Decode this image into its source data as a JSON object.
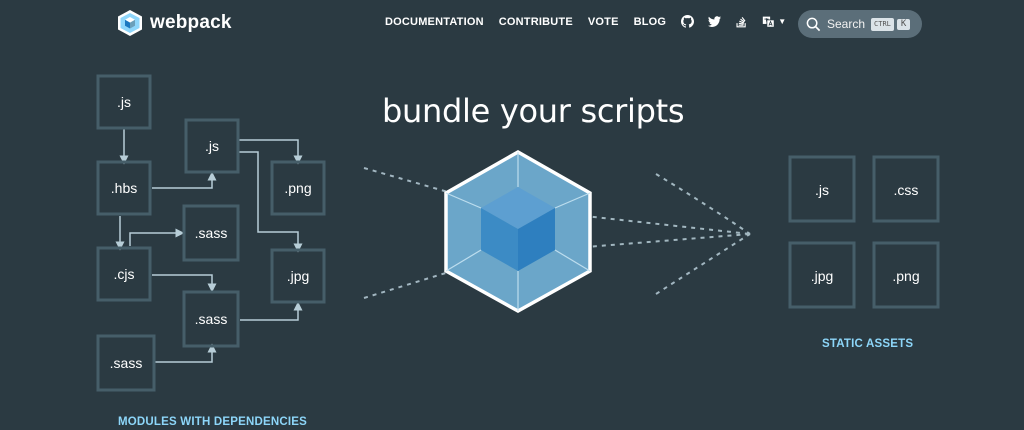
{
  "brand": {
    "name": "webpack"
  },
  "nav": {
    "links": [
      "DOCUMENTATION",
      "CONTRIBUTE",
      "VOTE",
      "BLOG"
    ],
    "icons": [
      "github-icon",
      "twitter-icon",
      "stackoverflow-icon",
      "language-icon",
      "theme-toggle-icon"
    ]
  },
  "search": {
    "label": "Search",
    "key_ctrl": "CTRL",
    "key_k": "K"
  },
  "hero": {
    "headline": "bundle your scripts"
  },
  "modules": {
    "caption": "MODULES WITH DEPENDENCIES",
    "boxes": [
      ".js",
      ".js",
      ".hbs",
      ".png",
      ".sass",
      ".cjs",
      ".jpg",
      ".sass",
      ".sass"
    ]
  },
  "assets": {
    "caption": "STATIC ASSETS",
    "boxes": [
      ".js",
      ".css",
      ".jpg",
      ".png"
    ]
  },
  "colors": {
    "background": "#2b3a42",
    "box_border": "#465e69",
    "accent": "#8dd6f9",
    "cube_outer": "#6ba6c9",
    "cube_inner": "#3c8bc5"
  }
}
